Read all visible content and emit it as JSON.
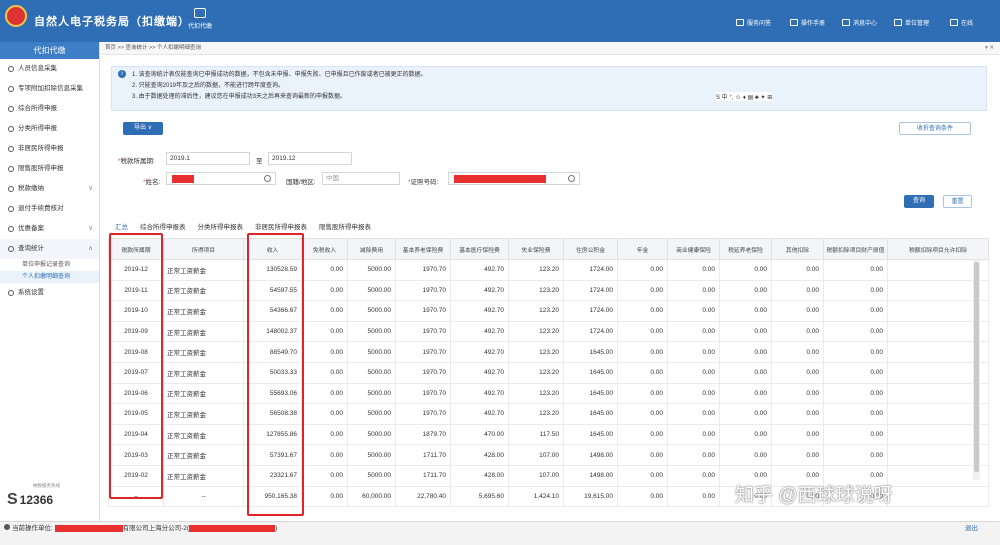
{
  "app": {
    "title": "自然人电子税务局（扣缴端）",
    "center_tool": "代扣代缴"
  },
  "topbar_right": [
    "服务问答",
    "操作手册",
    "消息中心",
    "单位管理",
    "在线"
  ],
  "sidebar": {
    "header": "代扣代缴",
    "items": [
      {
        "label": "人员信息采集"
      },
      {
        "label": "专项附加扣除信息采集"
      },
      {
        "label": "综合所得申报"
      },
      {
        "label": "分类所得申报"
      },
      {
        "label": "非居民所得申报"
      },
      {
        "label": "限售股所得申报"
      },
      {
        "label": "税款缴纳",
        "chevron": "∨"
      },
      {
        "label": "退付手续费核对"
      },
      {
        "label": "优惠备案",
        "chevron": "∨"
      },
      {
        "label": "查询统计",
        "chevron": "∧"
      }
    ],
    "subitems": [
      "单位申报记录查询",
      "个人扣缴明细查询"
    ],
    "last_item": "系统设置",
    "logo_text": "12366",
    "logo_caption": "纳税服务热线"
  },
  "breadcrumb": "首页 >> 查询统计 >> 个人扣缴明细查询",
  "notice": {
    "lines": [
      "1. 该查询统计表仅能查询已申报成功的数据，不包含未申报、申报失败、已申报且已作废或者已被更正的数据。",
      "2. 只能查询2019年及之后的数据，不能进行跨年度查询。",
      "3. 由于数据处理的滞后性，建议您在申报成功3天之后再来查询最新的申报数据。"
    ]
  },
  "ime_toolbar": "S 中 °, ☺ ♦ ▤ ♣ ✦ ⊞",
  "buttons": {
    "export": "导出 ∨",
    "collapse": "收折查询条件",
    "query": "查询",
    "reset": "重置"
  },
  "filters": {
    "period_label": "税款所属期:",
    "period_from": "2019.1",
    "period_to_sep": "至",
    "period_to": "2019.12",
    "name_label": "姓名:",
    "country_label": "国籍/地区:",
    "country_value": "中国",
    "id_label": "证照号码:"
  },
  "tabs": [
    "汇总",
    "综合所得申报表",
    "分类所得申报表",
    "非居民所得申报表",
    "限售股所得申报表"
  ],
  "table": {
    "headers": [
      "税款所属期",
      "所得项目",
      "收入",
      "免税收入",
      "减除费用",
      "基本养老保险费",
      "基本医疗保险费",
      "失业保险费",
      "住房公积金",
      "年金",
      "商业健康保险",
      "税延养老保险",
      "其他扣除",
      "税额扣除项目财产原值",
      "税额扣除项目允许扣除"
    ],
    "rows": [
      [
        "2019-12",
        "正常工资薪金",
        "130528.59",
        "0.00",
        "5000.00",
        "1970.70",
        "492.70",
        "123.20",
        "1724.00",
        "0.00",
        "0.00",
        "0.00",
        "0.00",
        "0.00",
        ""
      ],
      [
        "2019-11",
        "正常工资薪金",
        "54597.55",
        "0.00",
        "5000.00",
        "1970.70",
        "492.70",
        "123.20",
        "1724.00",
        "0.00",
        "0.00",
        "0.00",
        "0.00",
        "0.00",
        ""
      ],
      [
        "2019-10",
        "正常工资薪金",
        "54366.67",
        "0.00",
        "5000.00",
        "1970.70",
        "492.70",
        "123.20",
        "1724.00",
        "0.00",
        "0.00",
        "0.00",
        "0.00",
        "0.00",
        ""
      ],
      [
        "2019-09",
        "正常工资薪金",
        "148002.37",
        "0.00",
        "5000.00",
        "1970.70",
        "492.70",
        "123.20",
        "1724.00",
        "0.00",
        "0.00",
        "0.00",
        "0.00",
        "0.00",
        ""
      ],
      [
        "2019-08",
        "正常工资薪金",
        "88549.70",
        "0.00",
        "5000.00",
        "1970.70",
        "492.70",
        "123.20",
        "1645.00",
        "0.00",
        "0.00",
        "0.00",
        "0.00",
        "0.00",
        ""
      ],
      [
        "2019-07",
        "正常工资薪金",
        "50033.33",
        "0.00",
        "5000.00",
        "1970.70",
        "492.70",
        "123.20",
        "1645.00",
        "0.00",
        "0.00",
        "0.00",
        "0.00",
        "0.00",
        ""
      ],
      [
        "2019-06",
        "正常工资薪金",
        "55693.06",
        "0.00",
        "5000.00",
        "1970.70",
        "492.70",
        "123.20",
        "1645.00",
        "0.00",
        "0.00",
        "0.00",
        "0.00",
        "0.00",
        ""
      ],
      [
        "2019-05",
        "正常工资薪金",
        "56508.38",
        "0.00",
        "5000.00",
        "1970.70",
        "492.70",
        "123.20",
        "1645.00",
        "0.00",
        "0.00",
        "0.00",
        "0.00",
        "0.00",
        ""
      ],
      [
        "2019-04",
        "正常工资薪金",
        "127855.86",
        "0.00",
        "5000.00",
        "1879.70",
        "470.00",
        "117.50",
        "1645.00",
        "0.00",
        "0.00",
        "0.00",
        "0.00",
        "0.00",
        ""
      ],
      [
        "2019-03",
        "正常工资薪金",
        "57391.67",
        "0.00",
        "5000.00",
        "1711.70",
        "428.00",
        "107.00",
        "1498.00",
        "0.00",
        "0.00",
        "0.00",
        "0.00",
        "0.00",
        ""
      ],
      [
        "2019-02",
        "正常工资薪金",
        "23321.67",
        "0.00",
        "5000.00",
        "1711.70",
        "428.00",
        "107.00",
        "1498.00",
        "0.00",
        "0.00",
        "0.00",
        "0.00",
        "0.00",
        ""
      ]
    ],
    "total": [
      "--",
      "--",
      "950,165.38",
      "0.00",
      "60,000.00",
      "22,780.40",
      "5,695.60",
      "1,424.10",
      "19,615.00",
      "0.00",
      "0.00",
      "0.00",
      "0.00",
      "0.00",
      ""
    ]
  },
  "watermark": "知乎 @西球球说呀",
  "statusbar": {
    "operator_label": "当前操作单位:",
    "company_suffix": "有限公司上海分公司-2(",
    "close_paren": ")",
    "link": "退出"
  }
}
